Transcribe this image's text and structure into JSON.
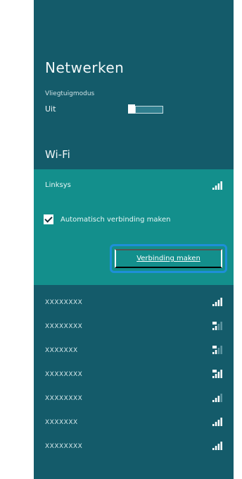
{
  "panel": {
    "title": "Netwerken",
    "airplane": {
      "label": "Vliegtuigmodus",
      "state": "Uit"
    },
    "wifi_heading": "Wi-Fi"
  },
  "selected_network": {
    "name": "Linksys",
    "signal_icon": "wifi-signal-full-icon",
    "auto_connect_label": "Automatisch verbinding maken",
    "auto_connect_checked": true,
    "connect_button_label": "Verbinding maken"
  },
  "networks": [
    {
      "name": "XXXXXXXX",
      "signal_icon": "wifi-signal-icon"
    },
    {
      "name": "XXXXXXXX",
      "signal_icon": "wifi-signal-secured-icon"
    },
    {
      "name": "XXXXXXX",
      "signal_icon": "wifi-signal-secured-icon"
    },
    {
      "name": "XXXXXXXX",
      "signal_icon": "wifi-signal-secured-icon"
    },
    {
      "name": "XXXXXXXX",
      "signal_icon": "wifi-signal-icon"
    },
    {
      "name": "XXXXXXX",
      "signal_icon": "wifi-signal-icon"
    },
    {
      "name": "XXXXXXXX",
      "signal_icon": "wifi-signal-icon"
    }
  ],
  "colors": {
    "panel_bg": "#145b6a",
    "selected_bg": "#138f8c",
    "focus_ring": "#1e8fd8"
  }
}
